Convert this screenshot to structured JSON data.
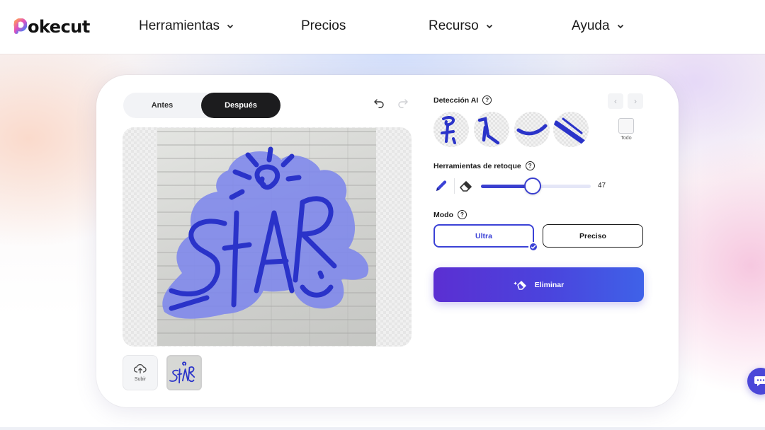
{
  "header": {
    "logo_text": "okecut",
    "nav": [
      {
        "label": "Herramientas",
        "has_dropdown": true
      },
      {
        "label": "Precios",
        "has_dropdown": false
      },
      {
        "label": "Recurso",
        "has_dropdown": true
      },
      {
        "label": "Ayuda",
        "has_dropdown": true
      }
    ]
  },
  "editor": {
    "toggle": {
      "before_label": "Antes",
      "after_label": "Después",
      "selected": "Después"
    },
    "upload_label": "Subir",
    "ai_detection": {
      "title": "Detección AI",
      "select_all_label": "Todo"
    },
    "retouch": {
      "title": "Herramientas de retoque",
      "brush_size": 47,
      "brush_size_max": 100
    },
    "mode": {
      "title": "Modo",
      "options": [
        "Ultra",
        "Preciso"
      ],
      "selected": "Ultra"
    },
    "remove_button": "Eliminar"
  },
  "colors": {
    "accent": "#3b42d6",
    "mask_fill": "#7d86ec",
    "graffiti": "#2a33c9",
    "button_gradient_start": "#5b2fd2",
    "button_gradient_end": "#3f62e8"
  },
  "icons": [
    "chevron-down-icon",
    "undo-icon",
    "redo-icon",
    "upload-icon",
    "help-icon",
    "pencil-icon",
    "eraser-icon",
    "magic-eraser-icon",
    "chat-icon",
    "prev-arrow-icon",
    "next-arrow-icon"
  ]
}
